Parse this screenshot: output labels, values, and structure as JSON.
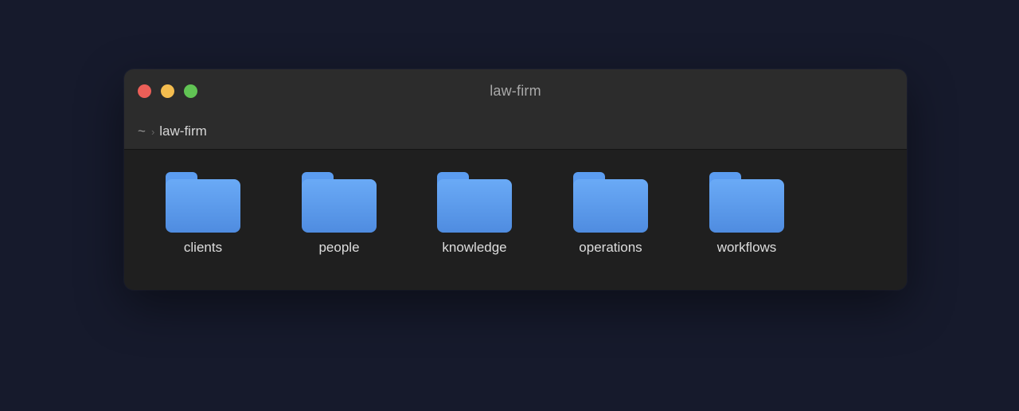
{
  "window": {
    "title": "law-firm",
    "traffic_lights": {
      "close_color": "#ec5f58",
      "minimize_color": "#f4bd4f",
      "maximize_color": "#61c454"
    }
  },
  "breadcrumb": {
    "home": "~",
    "separator": "›",
    "current": "law-firm"
  },
  "folders": [
    {
      "name": "clients",
      "icon": "folder-icon"
    },
    {
      "name": "people",
      "icon": "folder-icon"
    },
    {
      "name": "knowledge",
      "icon": "folder-icon"
    },
    {
      "name": "operations",
      "icon": "folder-icon"
    },
    {
      "name": "workflows",
      "icon": "folder-icon"
    }
  ]
}
